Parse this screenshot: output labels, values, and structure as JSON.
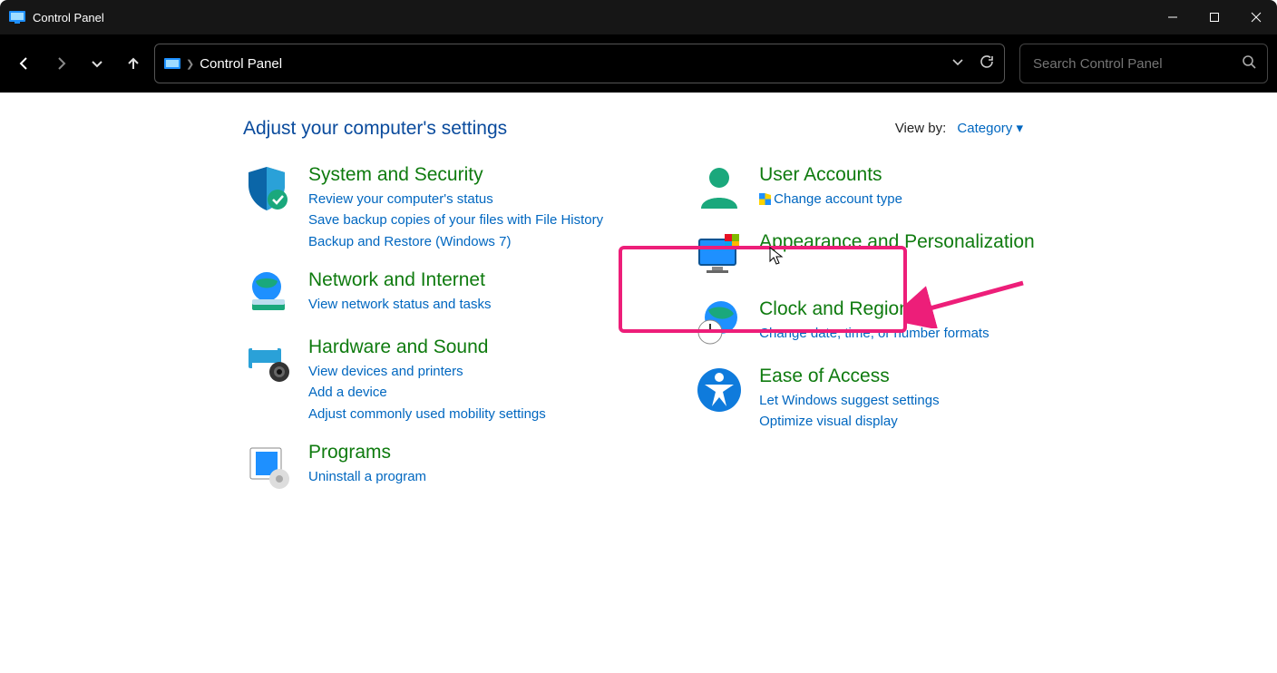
{
  "title": "Control Panel",
  "breadcrumb": {
    "root": "Control Panel"
  },
  "search_placeholder": "Search Control Panel",
  "heading": "Adjust your computer's settings",
  "viewby_label": "View by:",
  "viewby_value": "Category",
  "left": [
    {
      "title": "System and Security",
      "subs": [
        "Review your computer's status",
        "Save backup copies of your files with File History",
        "Backup and Restore (Windows 7)"
      ]
    },
    {
      "title": "Network and Internet",
      "subs": [
        "View network status and tasks"
      ]
    },
    {
      "title": "Hardware and Sound",
      "subs": [
        "View devices and printers",
        "Add a device",
        "Adjust commonly used mobility settings"
      ]
    },
    {
      "title": "Programs",
      "subs": [
        "Uninstall a program"
      ]
    }
  ],
  "right": [
    {
      "title": "User Accounts",
      "subs": [
        "Change account type"
      ],
      "shield": [
        true
      ]
    },
    {
      "title": "Appearance and Personalization",
      "subs": []
    },
    {
      "title": "Clock and Region",
      "subs": [
        "Change date, time, or number formats"
      ]
    },
    {
      "title": "Ease of Access",
      "subs": [
        "Let Windows suggest settings",
        "Optimize visual display"
      ]
    }
  ]
}
